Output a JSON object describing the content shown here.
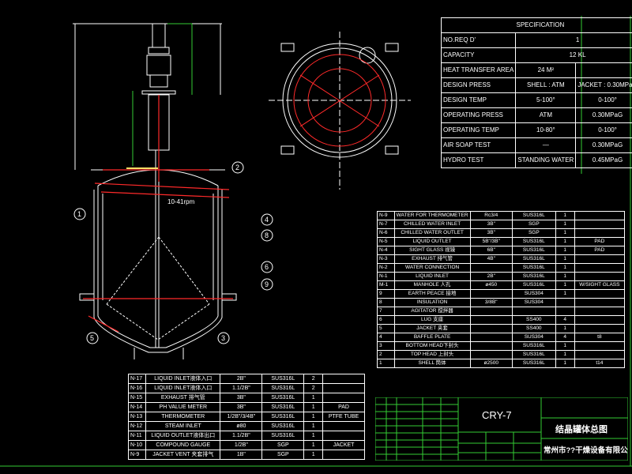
{
  "spec": {
    "header": "SPECIFICATION",
    "rows": [
      [
        "NO.REQ D'",
        "1",
        ""
      ],
      [
        "CAPACITY",
        "12  KL",
        ""
      ],
      [
        "HEAT TRANSFER AREA",
        "24 M²",
        ""
      ],
      [
        "DESIGN PRESS",
        "SHELL : ATM",
        "JACKET : 0.30MPaG"
      ],
      [
        "DESIGN TEMP",
        "5-100°",
        "0-100°"
      ],
      [
        "OPERATING PRESS",
        "ATM",
        "0.30MPaG"
      ],
      [
        "OPERATING TEMP",
        "10-80°",
        "0-100°"
      ],
      [
        "AIR SOAP TEST",
        "—",
        "0.30MPaG"
      ],
      [
        "HYDRO TEST",
        "STANDING WATER",
        "0.45MPaG"
      ]
    ]
  },
  "parts": {
    "rows": [
      [
        "N-9",
        "WATER FOR THERMOMETER",
        "Rc3/4",
        "SUS316L",
        "1",
        ""
      ],
      [
        "N-7",
        "CHILLED WATER INLET",
        "3B\"",
        "SGP",
        "1",
        ""
      ],
      [
        "N-6",
        "CHILLED WATER OUTLET",
        "3B\"",
        "SGP",
        "1",
        ""
      ],
      [
        "N-5",
        "LIQUID OUTLET",
        "5B\"/3B\"",
        "SUS316L",
        "1",
        "PAD"
      ],
      [
        "N-4",
        "SIGHT GLASS 视镜",
        "6B\"",
        "SUS316L",
        "1",
        "PAD"
      ],
      [
        "N-3",
        "EXHAUST 排气管",
        "4B\"",
        "SUS316L",
        "1",
        ""
      ],
      [
        "N-2",
        "WATER CONNECTION",
        "",
        "SUS316L",
        "1",
        ""
      ],
      [
        "N-1",
        "LIQUID INLET",
        "2B\"",
        "SUS316L",
        "1",
        ""
      ],
      [
        "M-1",
        "MANHOLE 人孔",
        "ø450",
        "SUS316L",
        "1",
        "W/SIGHT GLASS"
      ],
      [
        "9",
        "EARTH PEACE 接地",
        "",
        "SUS304",
        "1",
        ""
      ],
      [
        "8",
        "INSULATION",
        "3/8B\"",
        "SUS304",
        "",
        ""
      ],
      [
        "7",
        "AGITATOR 搅拌器",
        "",
        "",
        "",
        ""
      ],
      [
        "6",
        "LUG 支座",
        "",
        "SS400",
        "4",
        ""
      ],
      [
        "5",
        "JACKET 夹套",
        "",
        "SS400",
        "1",
        ""
      ],
      [
        "4",
        "BAFFLE PLATE",
        "",
        "SUS304",
        "4",
        "t8"
      ],
      [
        "3",
        "BOTTOM HEAD下封头",
        "",
        "SUS316L",
        "1",
        ""
      ],
      [
        "2",
        "TOP HEAD 上封头",
        "",
        "SUS316L",
        "1",
        ""
      ],
      [
        "1",
        "SHELL 筒体",
        "ø2500",
        "SUS316L",
        "1",
        "t14"
      ]
    ]
  },
  "nozzles": {
    "rows": [
      [
        "N-17",
        "LIQUID INLET液体入口",
        "2B\"",
        "SUS316L",
        "2",
        ""
      ],
      [
        "N-16",
        "LIQUID INLET液体入口",
        "1.1/2B\"",
        "SUS316L",
        "2",
        ""
      ],
      [
        "N-15",
        "EXHAUST 排气管",
        "3B\"",
        "SUS316L",
        "1",
        ""
      ],
      [
        "N-14",
        "PH VALUE METER",
        "3B\"",
        "SUS316L",
        "1",
        "PAD"
      ],
      [
        "N-13",
        "THERMOMETER",
        "1/2B\"/3/4B\"",
        "SUS316L",
        "1",
        "PTFE TUBE"
      ],
      [
        "N-12",
        "STEAM INLET",
        "ø80",
        "SUS316L",
        "1",
        ""
      ],
      [
        "N-11",
        "LIQUID OUTLET液体出口",
        "1.1/2B\"",
        "SUS316L",
        "1",
        ""
      ],
      [
        "N-10",
        "COMPOUND GAUGE",
        "1/2B\"",
        "SGP",
        "1",
        "JACKET"
      ],
      [
        "N-9",
        "JACKET VENT 夹套排气",
        "1B\"",
        "SGP",
        "1",
        ""
      ]
    ]
  },
  "title_block": {
    "drawing_no": "CRY-7",
    "drawing_title": "结晶罐体总图",
    "company": "常州市??干燥设备有限公司"
  },
  "drawing": {
    "speed_label": "10-41rpm",
    "balloons": [
      "1",
      "2",
      "3",
      "4",
      "5",
      "6",
      "8",
      "9"
    ]
  },
  "colors": {
    "line": "#ffffff",
    "accent": "#ff2a2a",
    "border": "#33cc33",
    "dim": "#ffe066"
  }
}
